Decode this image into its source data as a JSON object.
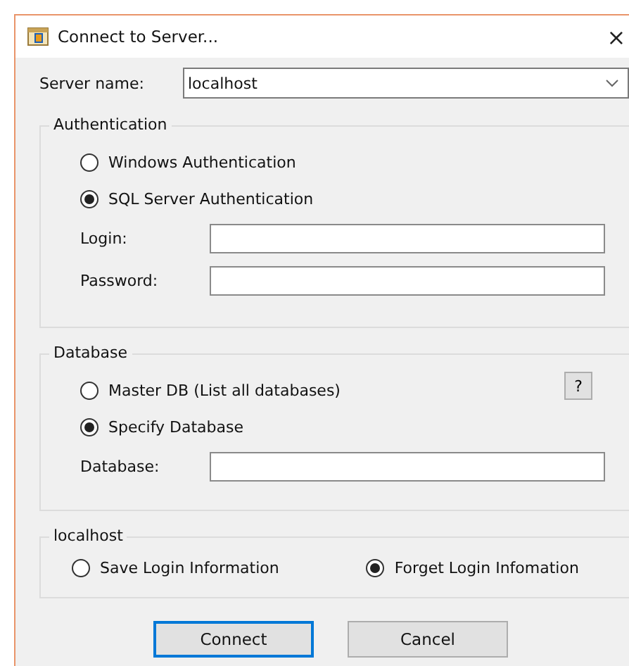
{
  "window": {
    "title": "Connect to Server...",
    "close": "×"
  },
  "server_name": {
    "label": "Server name:",
    "value": "localhost"
  },
  "authentication": {
    "title": "Authentication",
    "options": [
      {
        "label": "Windows Authentication",
        "selected": false
      },
      {
        "label": "SQL Server Authentication",
        "selected": true
      }
    ],
    "fields": [
      {
        "label": "Login:"
      },
      {
        "label": "Password:"
      }
    ]
  },
  "database": {
    "title": "Database",
    "help": "?",
    "options": [
      {
        "label": "Master DB (List all databases)",
        "selected": false
      },
      {
        "label": "Specify Database",
        "selected": true
      }
    ],
    "fields": [
      {
        "label": "Database:"
      }
    ]
  },
  "login_info": {
    "title": "localhost",
    "options": [
      {
        "label": "Save Login Information",
        "selected": false
      },
      {
        "label": "Forget Login Infomation",
        "selected": true
      }
    ]
  },
  "buttons": [
    {
      "label": "Connect",
      "default": true
    },
    {
      "label": "Cancel",
      "default": false
    }
  ]
}
